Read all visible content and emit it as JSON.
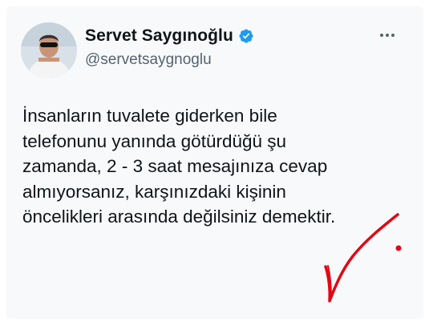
{
  "author": {
    "name": "Servet Saygınoğlu",
    "handle": "@servetsaygnoglu",
    "verified_icon": "verified-badge-icon",
    "brand_color": "#1d9bf0"
  },
  "tweet": {
    "lines": [
      "İnsanların tuvalete giderken bile",
      "telefonunu yanında götürdüğü şu",
      "zamanda, 2 - 3 saat mesajınıza cevap",
      "almıyorsanız, karşınızdaki kişinin",
      "öncelikleri arasında değilsiniz demektir."
    ]
  },
  "annotation": {
    "icon": "red-checkmark-icon",
    "color": "#e30613"
  },
  "menu": {
    "icon": "more-options-icon"
  }
}
